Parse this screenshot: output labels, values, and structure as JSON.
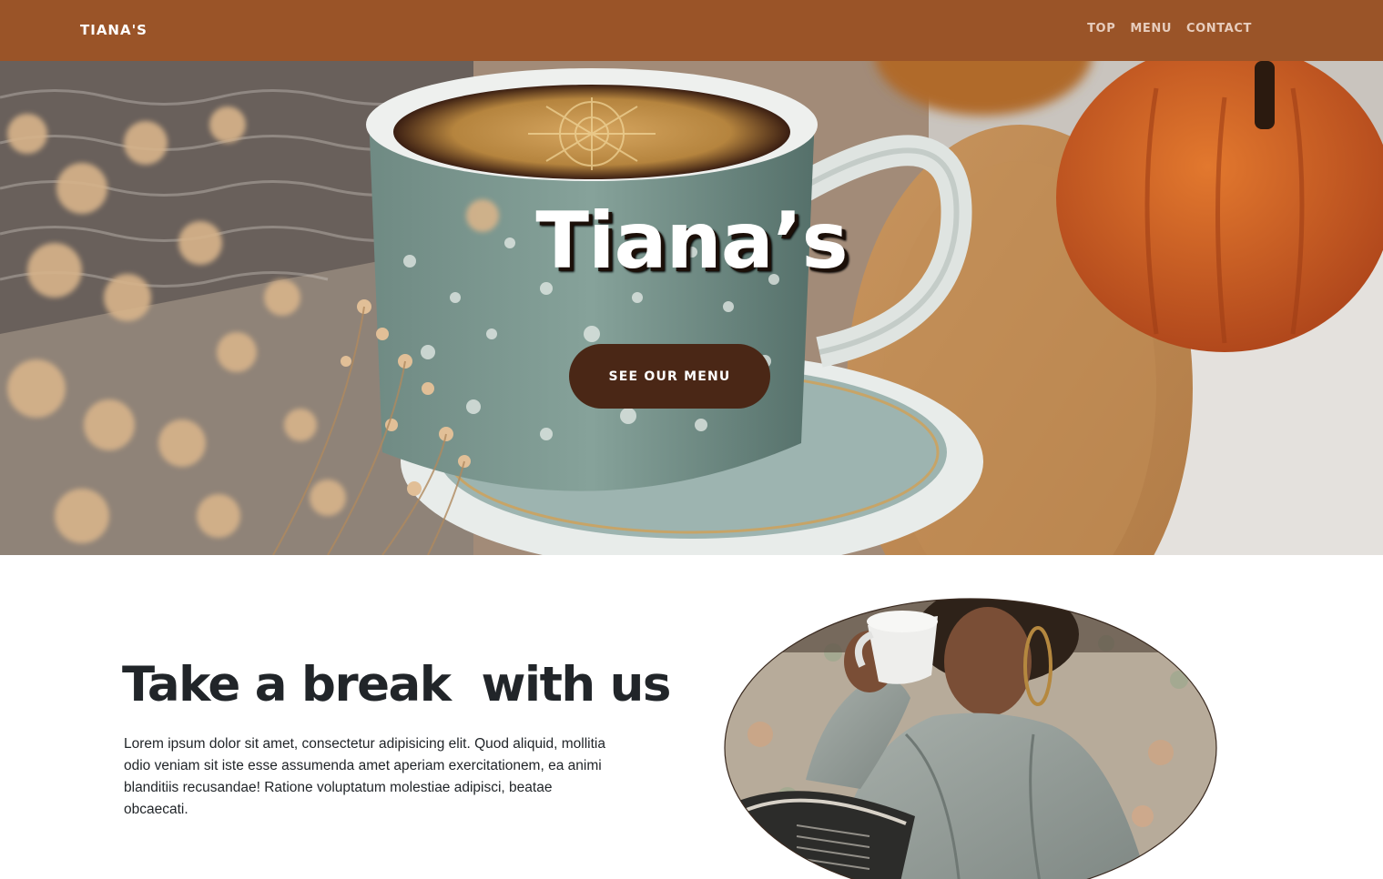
{
  "navbar": {
    "brand": "TIANA'S",
    "links": [
      "TOP",
      "MENU",
      "CONTACT"
    ]
  },
  "hero": {
    "title": "Tiana’s",
    "button_label": "SEE OUR MENU"
  },
  "about": {
    "heading": "Take a break  with us",
    "text": "Lorem ipsum dolor sit amet, consectetur adipisicing elit. Quod aliquid, mollitia odio veniam sit iste esse assumenda amet aperiam exercitationem, ea animi blanditiis recusandae! Ratione voluptatum molestiae adipisci, beatae obcaecati."
  },
  "colors": {
    "navbar_bg": "#9a5428",
    "button_bg": "#4a2716",
    "heading_text": "#212529"
  }
}
